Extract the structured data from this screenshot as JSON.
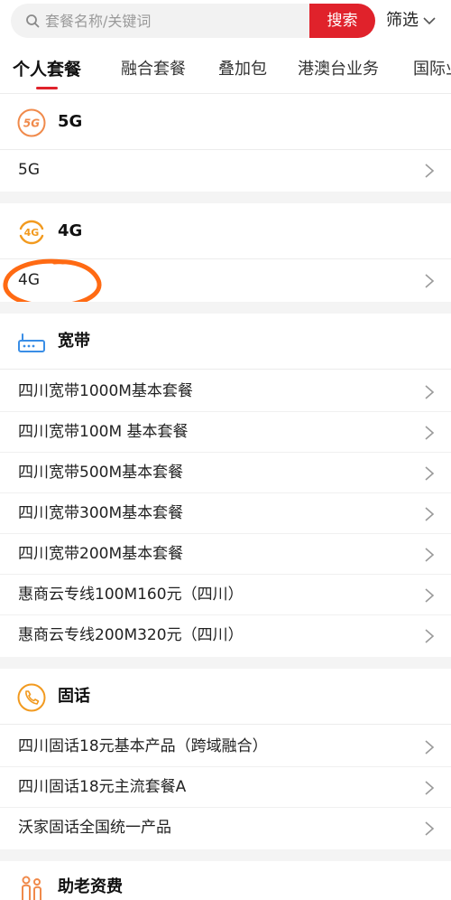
{
  "search": {
    "placeholder": "套餐名称/关键词",
    "button_label": "搜索",
    "filter_label": "筛选"
  },
  "tabs": [
    {
      "label": "个人套餐",
      "active": true
    },
    {
      "label": "融合套餐",
      "active": false
    },
    {
      "label": "叠加包",
      "active": false
    },
    {
      "label": "港澳台业务",
      "active": false
    },
    {
      "label": "国际业务",
      "active": false
    }
  ],
  "sections": [
    {
      "title": "5G",
      "icon": "5g-icon",
      "items": [
        "5G"
      ]
    },
    {
      "title": "4G",
      "icon": "4g-icon",
      "items": [
        "4G"
      ]
    },
    {
      "title": "宽带",
      "icon": "router-icon",
      "items": [
        "四川宽带1000M基本套餐",
        "四川宽带100M 基本套餐",
        "四川宽带500M基本套餐",
        "四川宽带300M基本套餐",
        "四川宽带200M基本套餐",
        "惠商云专线100M160元（四川）",
        "惠商云专线200M320元（四川）"
      ]
    },
    {
      "title": "固话",
      "icon": "phone-icon",
      "items": [
        "四川固话18元基本产品（跨域融合）",
        "四川固话18元主流套餐A",
        "沃家固话全国统一产品"
      ]
    },
    {
      "title": "助老资费",
      "icon": "elderly-care-icon",
      "items": []
    }
  ],
  "colors": {
    "brand_red": "#e0222b",
    "icon_orange": "#f29a1f",
    "icon_blue": "#3a8ee6",
    "annotation_orange": "#ff6a13",
    "section_gap": "#f4f4f4"
  }
}
